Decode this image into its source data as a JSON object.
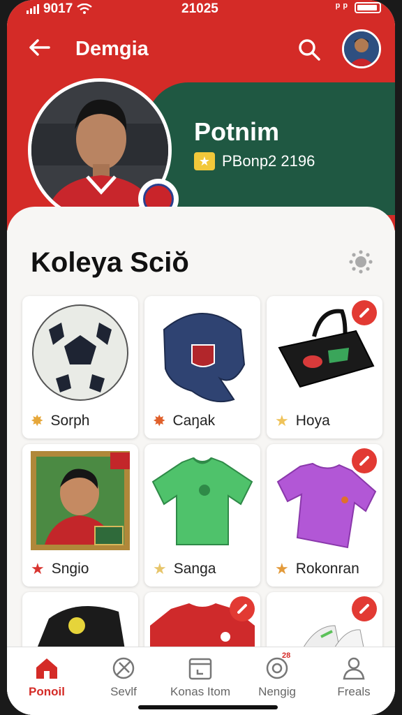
{
  "status_bar": {
    "left_text": "9017",
    "center_text": "21025",
    "right_text": "ᵖ ᵖ"
  },
  "header": {
    "title": "Demgia",
    "back_icon": "arrow-left-icon",
    "search_icon": "search-icon"
  },
  "profile": {
    "name": "Potnim",
    "rank_text": "PBonp2 2196"
  },
  "collection": {
    "title": "Koleya Sciŏ",
    "items": [
      {
        "label": "Sorph",
        "icon": "gold-medal-icon",
        "removable": false
      },
      {
        "label": "Caŋak",
        "icon": "orange-medal-icon",
        "removable": false
      },
      {
        "label": "Hoya",
        "icon": "star-icon",
        "removable": true
      },
      {
        "label": "Sngio",
        "icon": "red-star-icon",
        "removable": false
      },
      {
        "label": "Sanga",
        "icon": "star-icon",
        "removable": false
      },
      {
        "label": "Rokonran",
        "icon": "orange-star-icon",
        "removable": true
      },
      {
        "label": "",
        "icon": "",
        "removable": false
      },
      {
        "label": "",
        "icon": "",
        "removable": true
      },
      {
        "label": "",
        "icon": "",
        "removable": true
      }
    ]
  },
  "nav": {
    "items": [
      {
        "label": "Ponoil",
        "icon": "home-icon",
        "active": true
      },
      {
        "label": "Sevlf",
        "icon": "ball-icon",
        "active": false
      },
      {
        "label": "Konas Itom",
        "icon": "calendar-icon",
        "active": false
      },
      {
        "label": "Nengig",
        "icon": "target-icon",
        "active": false,
        "badge": "28"
      },
      {
        "label": "Freals",
        "icon": "person-icon",
        "active": false
      }
    ]
  },
  "colors": {
    "primary_red": "#d42b27",
    "dark_green": "#1f5842"
  }
}
